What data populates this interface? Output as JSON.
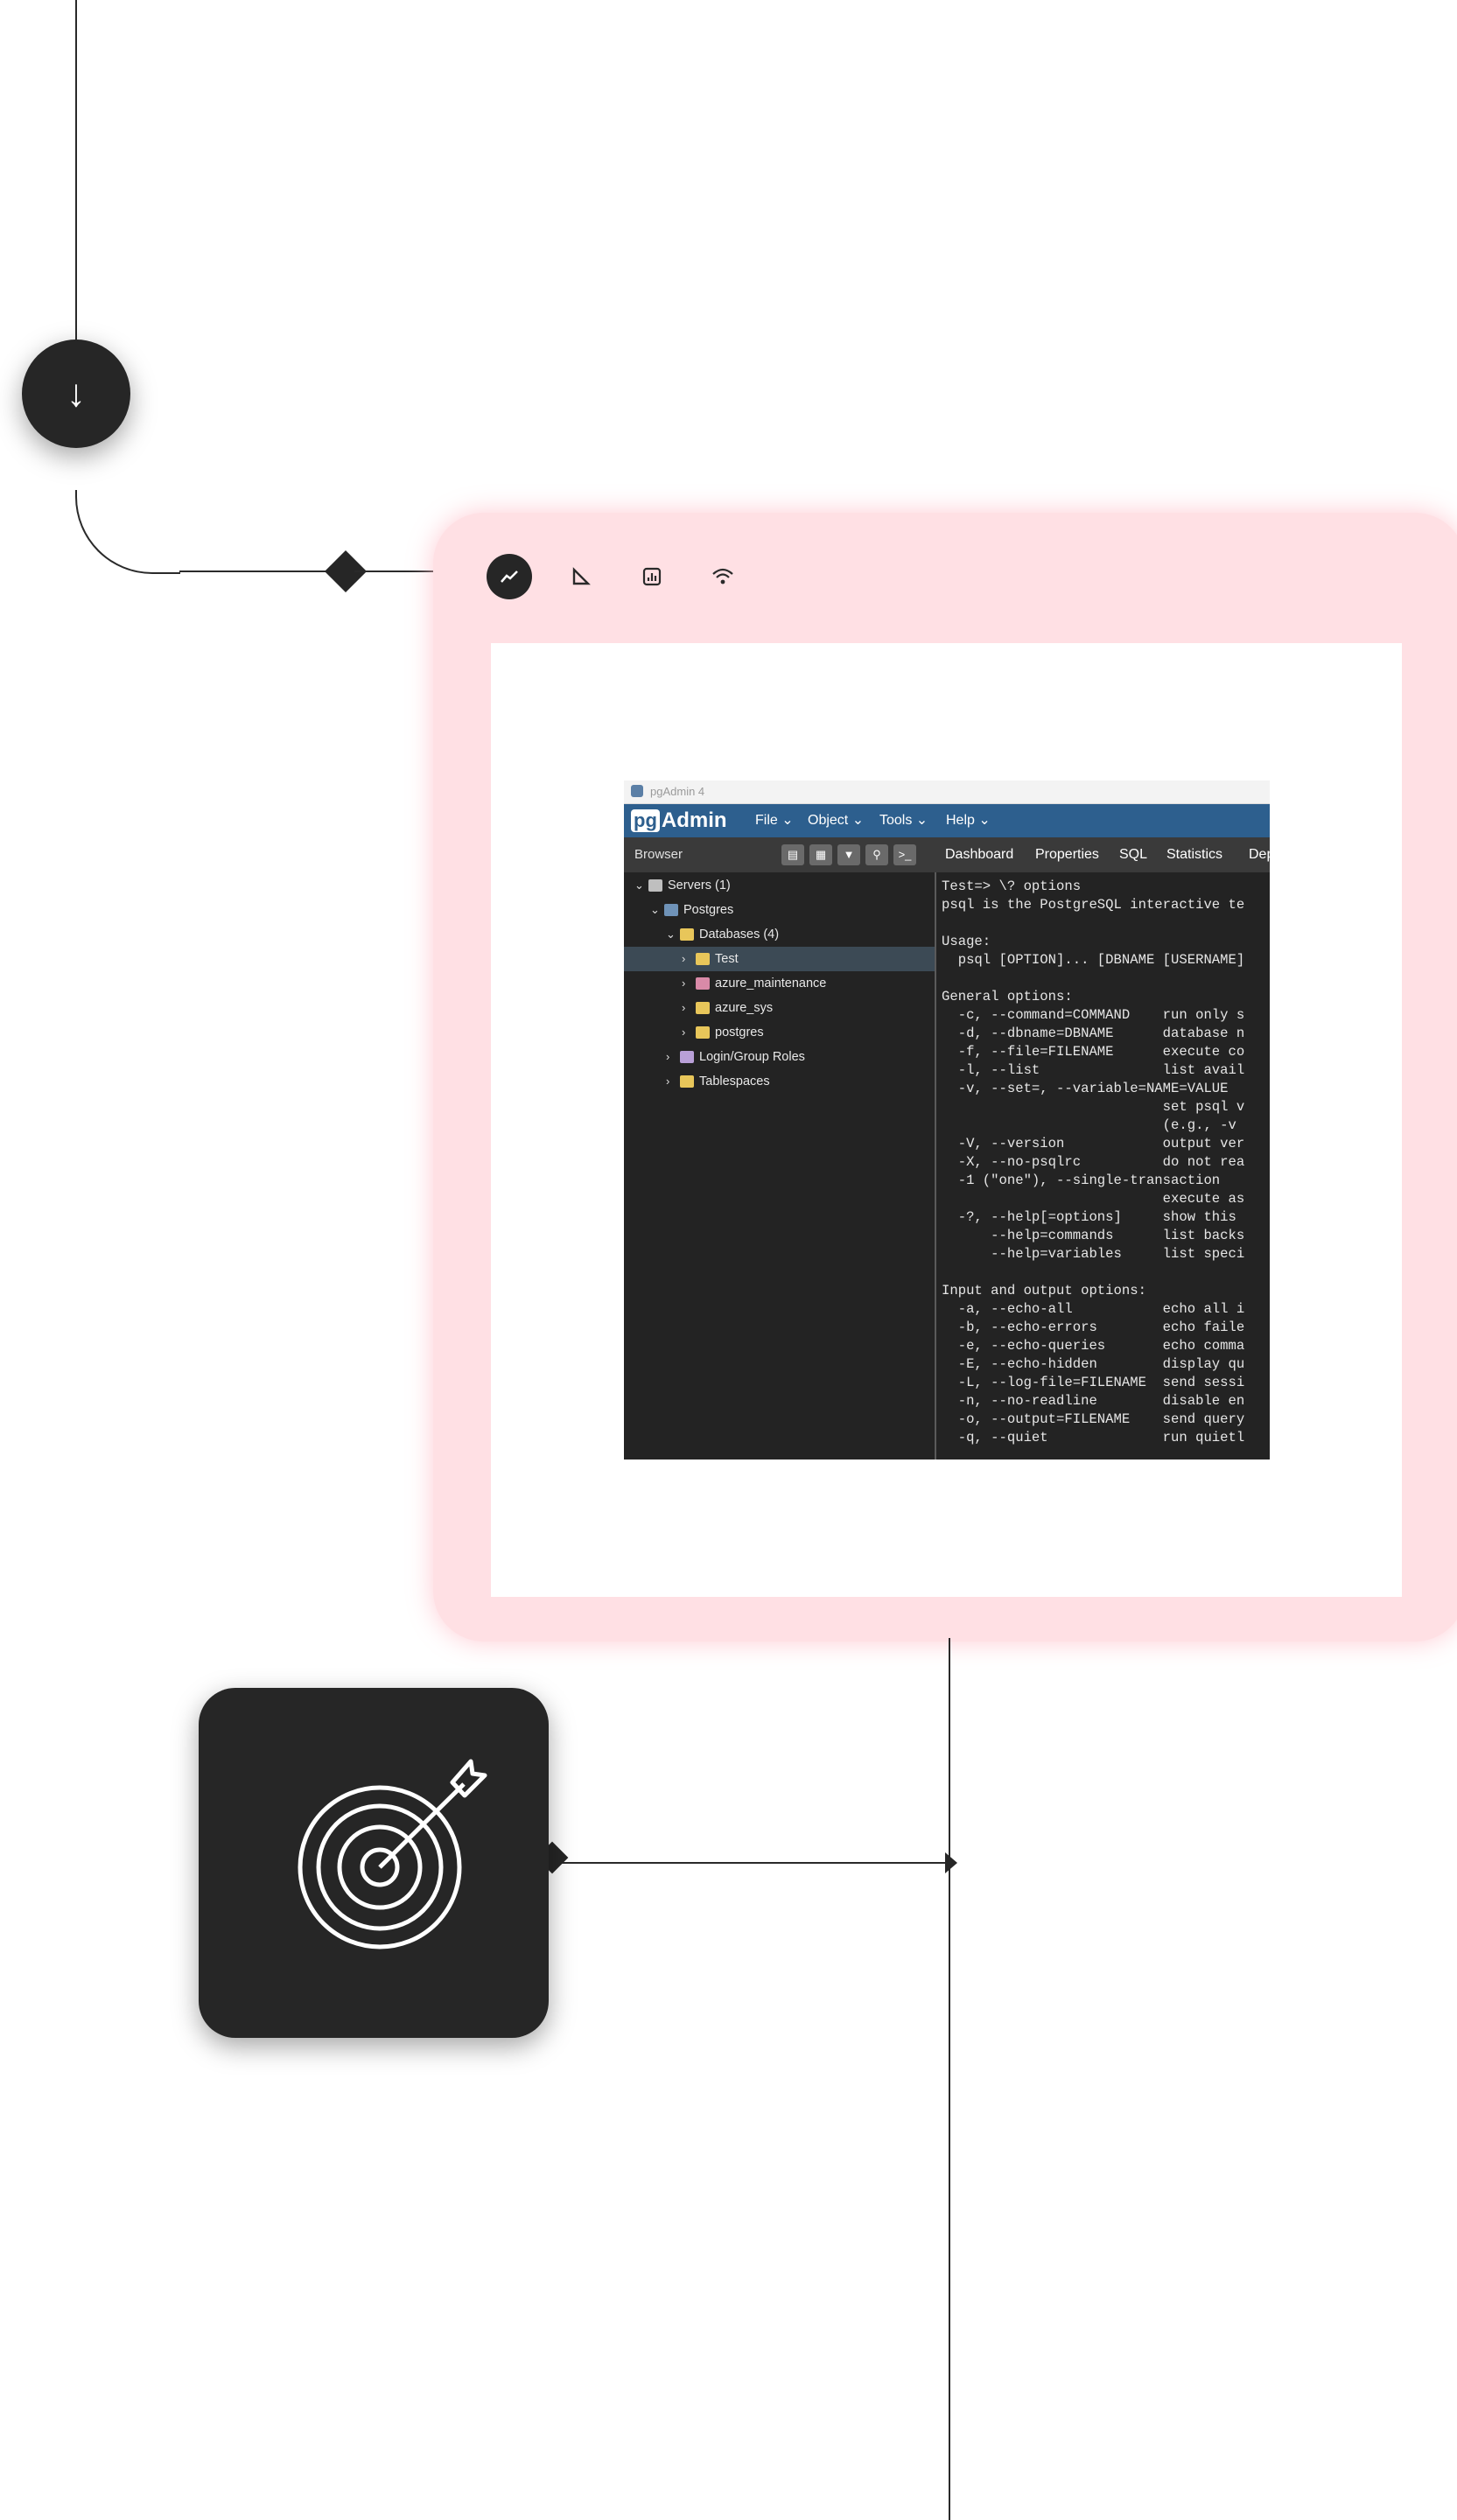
{
  "colors": {
    "dark": "#262626",
    "card_bg": "#ffe0e4",
    "pgadmin_blue": "#2d5f8e"
  },
  "flow": {
    "down_button_glyph": "↓"
  },
  "toolbar_icons": [
    "trend-line-icon",
    "triangle-ruler-icon",
    "bar-chart-icon",
    "wifi-icon"
  ],
  "pgadmin": {
    "window_title": "pgAdmin 4",
    "logo_pg": "pg",
    "logo_text": "Admin",
    "menu": [
      "File ⌄",
      "Object ⌄",
      "Tools ⌄",
      "Help ⌄"
    ],
    "browser_label": "Browser",
    "tabs": [
      "Dashboard",
      "Properties",
      "SQL",
      "Statistics",
      "Dep"
    ],
    "tree": {
      "servers": "Servers (1)",
      "postgres_server": "Postgres",
      "databases": "Databases (4)",
      "db_test": "Test",
      "db_azure_maintenance": "azure_maintenance",
      "db_azure_sys": "azure_sys",
      "db_postgres": "postgres",
      "login_roles": "Login/Group Roles",
      "tablespaces": "Tablespaces"
    },
    "console_text": "Test=> \\? options\npsql is the PostgreSQL interactive te\n\nUsage:\n  psql [OPTION]... [DBNAME [USERNAME]\n\nGeneral options:\n  -c, --command=COMMAND    run only s\n  -d, --dbname=DBNAME      database n\n  -f, --file=FILENAME      execute co\n  -l, --list               list avail\n  -v, --set=, --variable=NAME=VALUE\n                           set psql v\n                           (e.g., -v\n  -V, --version            output ver\n  -X, --no-psqlrc          do not rea\n  -1 (\"one\"), --single-transaction\n                           execute as\n  -?, --help[=options]     show this\n      --help=commands      list backs\n      --help=variables     list speci\n\nInput and output options:\n  -a, --echo-all           echo all i\n  -b, --echo-errors        echo faile\n  -e, --echo-queries       echo comma\n  -E, --echo-hidden        display qu\n  -L, --log-file=FILENAME  send sessi\n  -n, --no-readline        disable en\n  -o, --output=FILENAME    send query\n  -q, --quiet              run quietl"
  }
}
